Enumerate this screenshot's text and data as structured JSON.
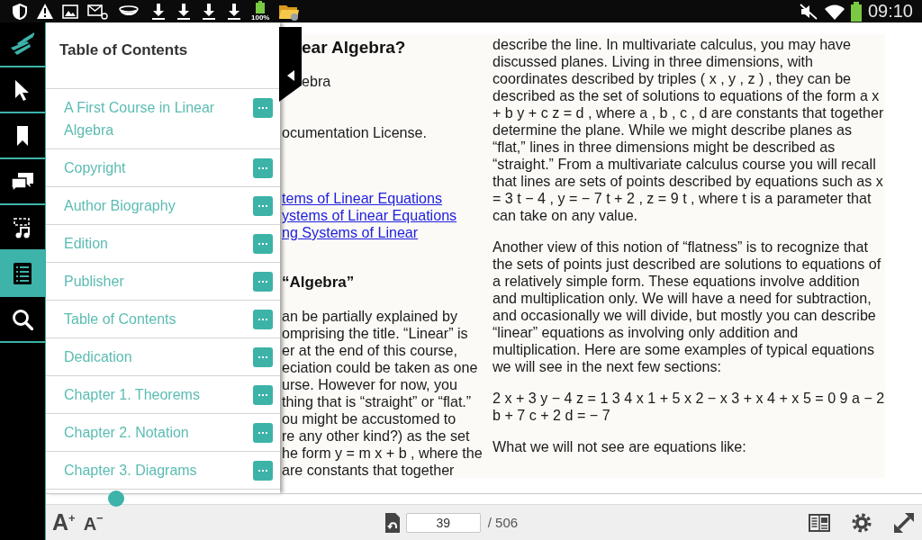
{
  "status_bar": {
    "battery_percent": "100%",
    "time": "09:10"
  },
  "sidebar": {
    "items": [
      {
        "kind": "select",
        "selected": false
      },
      {
        "kind": "bookmark",
        "selected": false
      },
      {
        "kind": "notes",
        "selected": false
      },
      {
        "kind": "media",
        "selected": false
      },
      {
        "kind": "contents",
        "selected": true
      },
      {
        "kind": "search",
        "selected": false
      }
    ]
  },
  "toc_panel": {
    "title": "Table of Contents",
    "items": [
      {
        "label": "A First Course in Linear Algebra"
      },
      {
        "label": "Copyright"
      },
      {
        "label": "Author Biography"
      },
      {
        "label": "Edition"
      },
      {
        "label": "Publisher"
      },
      {
        "label": "Table of Contents"
      },
      {
        "label": "Dedication"
      },
      {
        "label": "Chapter 1. Theorems"
      },
      {
        "label": "Chapter 2. Notation"
      },
      {
        "label": "Chapter 3. Diagrams"
      }
    ]
  },
  "page": {
    "left_column": [
      {
        "kind": "heading",
        "text": "ear Algebra?"
      },
      {
        "kind": "text",
        "text": "ebra"
      },
      {
        "kind": "text",
        "text": "ocumentation License."
      },
      {
        "kind": "link",
        "text": "tems of Linear Equations"
      },
      {
        "kind": "link",
        "text": "ystems of Linear Equations"
      },
      {
        "kind": "link",
        "text": "ng Systems of Linear"
      },
      {
        "kind": "subheading",
        "text": "“Algebra”"
      },
      {
        "kind": "text",
        "text": "an be partially explained by"
      },
      {
        "kind": "text",
        "text": "omprising the title. “Linear” is"
      },
      {
        "kind": "text",
        "text": "er at the end of this course,"
      },
      {
        "kind": "text",
        "text": "eciation could be taken as one"
      },
      {
        "kind": "text",
        "text": "urse. However for now, you"
      },
      {
        "kind": "text",
        "text": "thing that is “straight” or “flat.”"
      },
      {
        "kind": "text",
        "text": "ou might be accustomed to"
      },
      {
        "kind": "text",
        "text": "re any other kind?) as the set"
      },
      {
        "kind": "text",
        "text": "he form y = m x + b , where the"
      },
      {
        "kind": "text",
        "text": "are constants that together"
      }
    ],
    "right_column": [
      "describe the line. In multivariate calculus, you may have discussed planes. Living in three dimensions, with coordinates described by triples ( x , y , z ) , they can be described as the set of solutions to equations of the form a x + b y + c z = d , where a , b , c , d are constants that together determine the plane. While we might describe planes as “flat,” lines in three dimensions might be described as “straight.” From a multivariate calculus course you will recall that lines are sets of points described by equations such as x = 3 t − 4 , y = − 7 t + 2 , z = 9 t , where t is a parameter that can take on any value.",
      "Another view of this notion of “flatness” is to recognize that the sets of points just described are solutions to equations of a relatively simple form. These equations involve addition and multiplication only. We will have a need for subtraction, and occasionally we will divide, but mostly you can describe “linear” equations as involving only addition and multiplication. Here are some examples of typical equations we will see in the next few sections:",
      "2 x + 3 y − 4 z = 1 3 4 x 1 + 5 x 2 − x 3 + x 4 + x 5 = 0 9 a − 2 b + 7 c + 2 d = − 7",
      "What we will not see are equations like:"
    ]
  },
  "bottom_bar": {
    "slider": {
      "level": 0.08
    },
    "font_buttons": [
      {
        "label": "A$^{+}$"
      },
      {
        "label": "A$^{−}$"
      }
    ],
    "page_field": {
      "value": "39"
    },
    "page_total": "/ 506"
  }
}
